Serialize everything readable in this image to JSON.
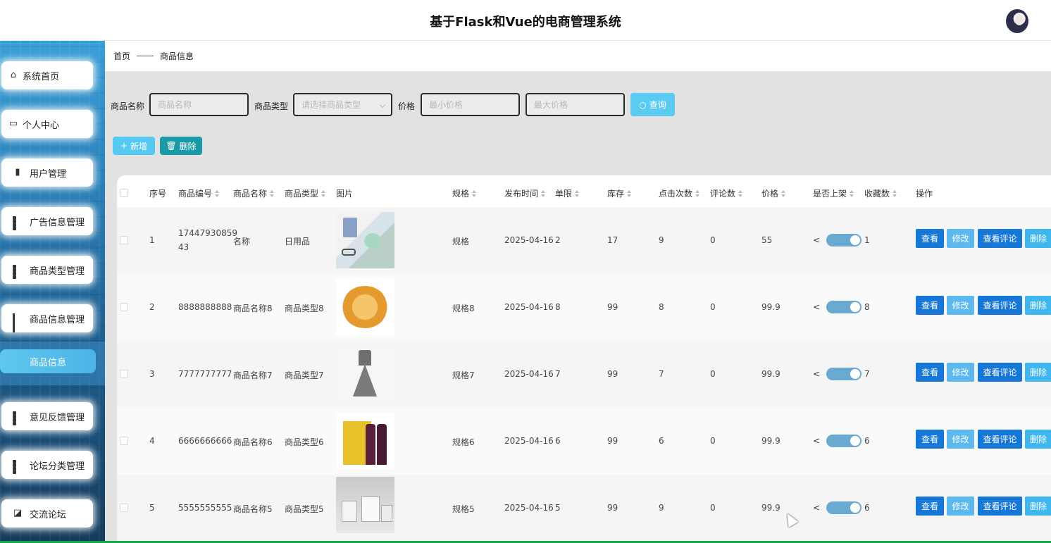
{
  "header": {
    "title": "基于Flask和Vue的电商管理系统"
  },
  "sidebar": {
    "items": [
      {
        "label": "系统首页",
        "icon": "home-icon"
      },
      {
        "label": "个人中心",
        "icon": "card-icon"
      },
      {
        "label": "用户管理",
        "icon": "clipboard-icon"
      },
      {
        "label": "广告信息管理",
        "icon": "grid-icon"
      },
      {
        "label": "商品类型管理",
        "icon": "grid-icon"
      },
      {
        "label": "商品信息管理",
        "icon": "grid9-icon"
      },
      {
        "label": "意见反馈管理",
        "icon": "grid-icon"
      },
      {
        "label": "论坛分类管理",
        "icon": "grid-icon"
      },
      {
        "label": "交流论坛",
        "icon": "chart-icon"
      }
    ],
    "active_submenu": "商品信息"
  },
  "breadcrumb": {
    "home": "首页",
    "current": "商品信息"
  },
  "search": {
    "name_label": "商品名称",
    "name_placeholder": "商品名称",
    "type_label": "商品类型",
    "type_placeholder": "请选择商品类型",
    "price_label": "价格",
    "min_price_placeholder": "最小价格",
    "max_price_placeholder": "最大价格",
    "query_button": "查询"
  },
  "toolbar": {
    "add_button": "新增",
    "delete_button": "删除"
  },
  "table": {
    "headers": [
      "序号",
      "商品编号",
      "商品名称",
      "商品类型",
      "图片",
      "规格",
      "发布时间",
      "单限",
      "库存",
      "点击次数",
      "评论数",
      "价格",
      "是否上架",
      "收藏数",
      "操作"
    ],
    "actions": {
      "view": "查看",
      "edit": "修改",
      "comments": "查看评论",
      "delete": "删除"
    },
    "rows": [
      {
        "index": "1",
        "code_line1": "17447930859",
        "code_line2": "43",
        "name": "名称",
        "type": "日用品",
        "image": "household-goods-photo",
        "spec": "规格",
        "date": "2025-04-16",
        "limit": "2",
        "stock": "17",
        "clicks": "9",
        "comments": "0",
        "price": "55",
        "listed": true,
        "favorites": "1"
      },
      {
        "index": "2",
        "code_line1": "8888888888",
        "code_line2": "",
        "name": "商品名称8",
        "type": "商品类型8",
        "image": "snack-photo",
        "spec": "规格8",
        "date": "2025-04-16",
        "limit": "8",
        "stock": "99",
        "clicks": "8",
        "comments": "0",
        "price": "99.9",
        "listed": true,
        "favorites": "8"
      },
      {
        "index": "3",
        "code_line1": "7777777777",
        "code_line2": "",
        "name": "商品名称7",
        "type": "商品类型7",
        "image": "dress-photo",
        "spec": "规格7",
        "date": "2025-04-16",
        "limit": "7",
        "stock": "99",
        "clicks": "7",
        "comments": "0",
        "price": "99.9",
        "listed": true,
        "favorites": "7"
      },
      {
        "index": "4",
        "code_line1": "6666666666",
        "code_line2": "",
        "name": "商品名称6",
        "type": "商品类型6",
        "image": "wine-box-photo",
        "spec": "规格6",
        "date": "2025-04-16",
        "limit": "6",
        "stock": "99",
        "clicks": "6",
        "comments": "0",
        "price": "99.9",
        "listed": true,
        "favorites": "6"
      },
      {
        "index": "5",
        "code_line1": "5555555555",
        "code_line2": "",
        "name": "商品名称5",
        "type": "商品类型5",
        "image": "paper-bags-photo",
        "spec": "规格5",
        "date": "2025-04-16",
        "limit": "5",
        "stock": "99",
        "clicks": "9",
        "comments": "0",
        "price": "99.9",
        "listed": true,
        "favorites": "6"
      }
    ]
  },
  "colors": {
    "primary": "#1677d6",
    "light_blue": "#5cb8ee",
    "teal": "#1a9aa6",
    "toggle_on": "#6aa9d0"
  }
}
